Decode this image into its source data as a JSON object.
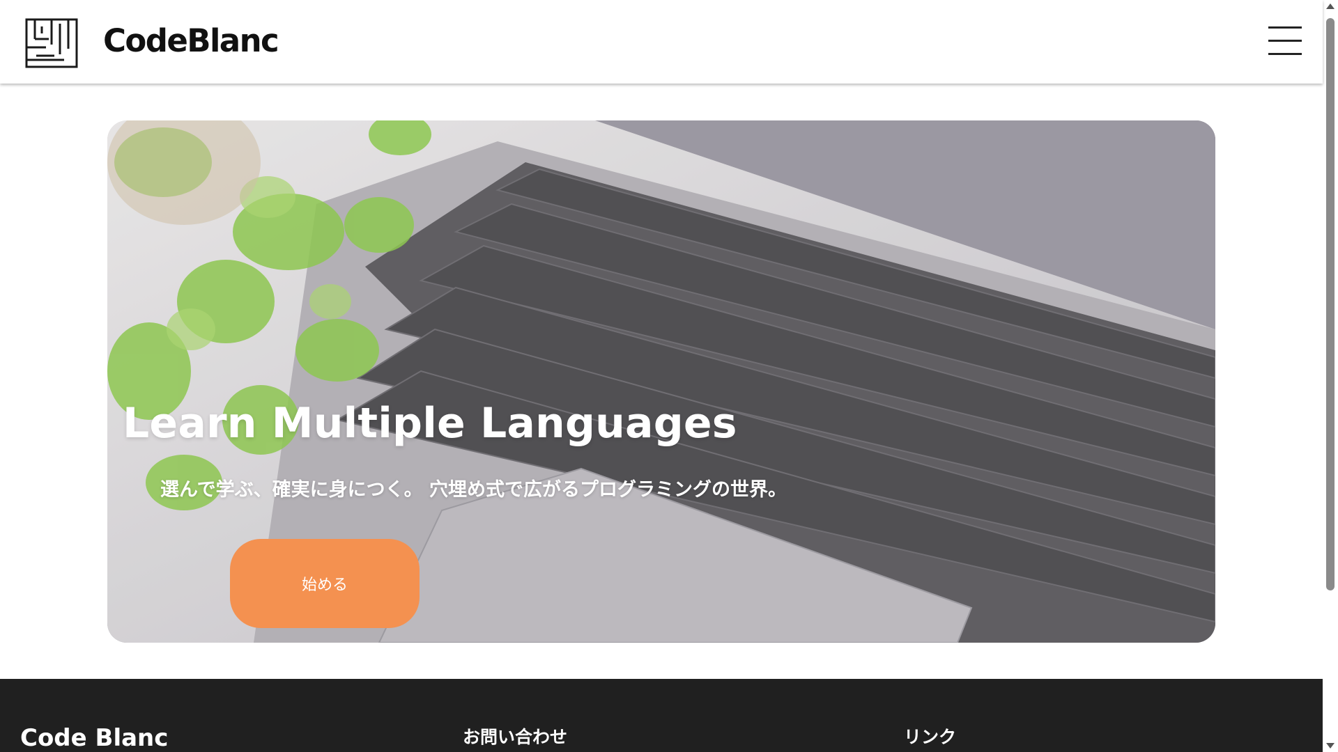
{
  "header": {
    "brand": "CodeBlanc",
    "logo_icon": "circuit-logo-icon",
    "menu_icon": "hamburger-menu-icon"
  },
  "hero": {
    "title": "Learn Multiple Languages",
    "subtitle": "選んで学ぶ、確実に身につく。 穴埋め式で広がるプログラミングの世界。",
    "cta_label": "始める",
    "image": "laptop-keyboard-with-plant-photo"
  },
  "footer": {
    "brand": "Code Blanc",
    "contact_heading": "お問い合わせ",
    "links_heading": "リンク"
  },
  "colors": {
    "accent": "#f49150",
    "footer_bg": "#202020",
    "header_bg": "#ffffff"
  }
}
